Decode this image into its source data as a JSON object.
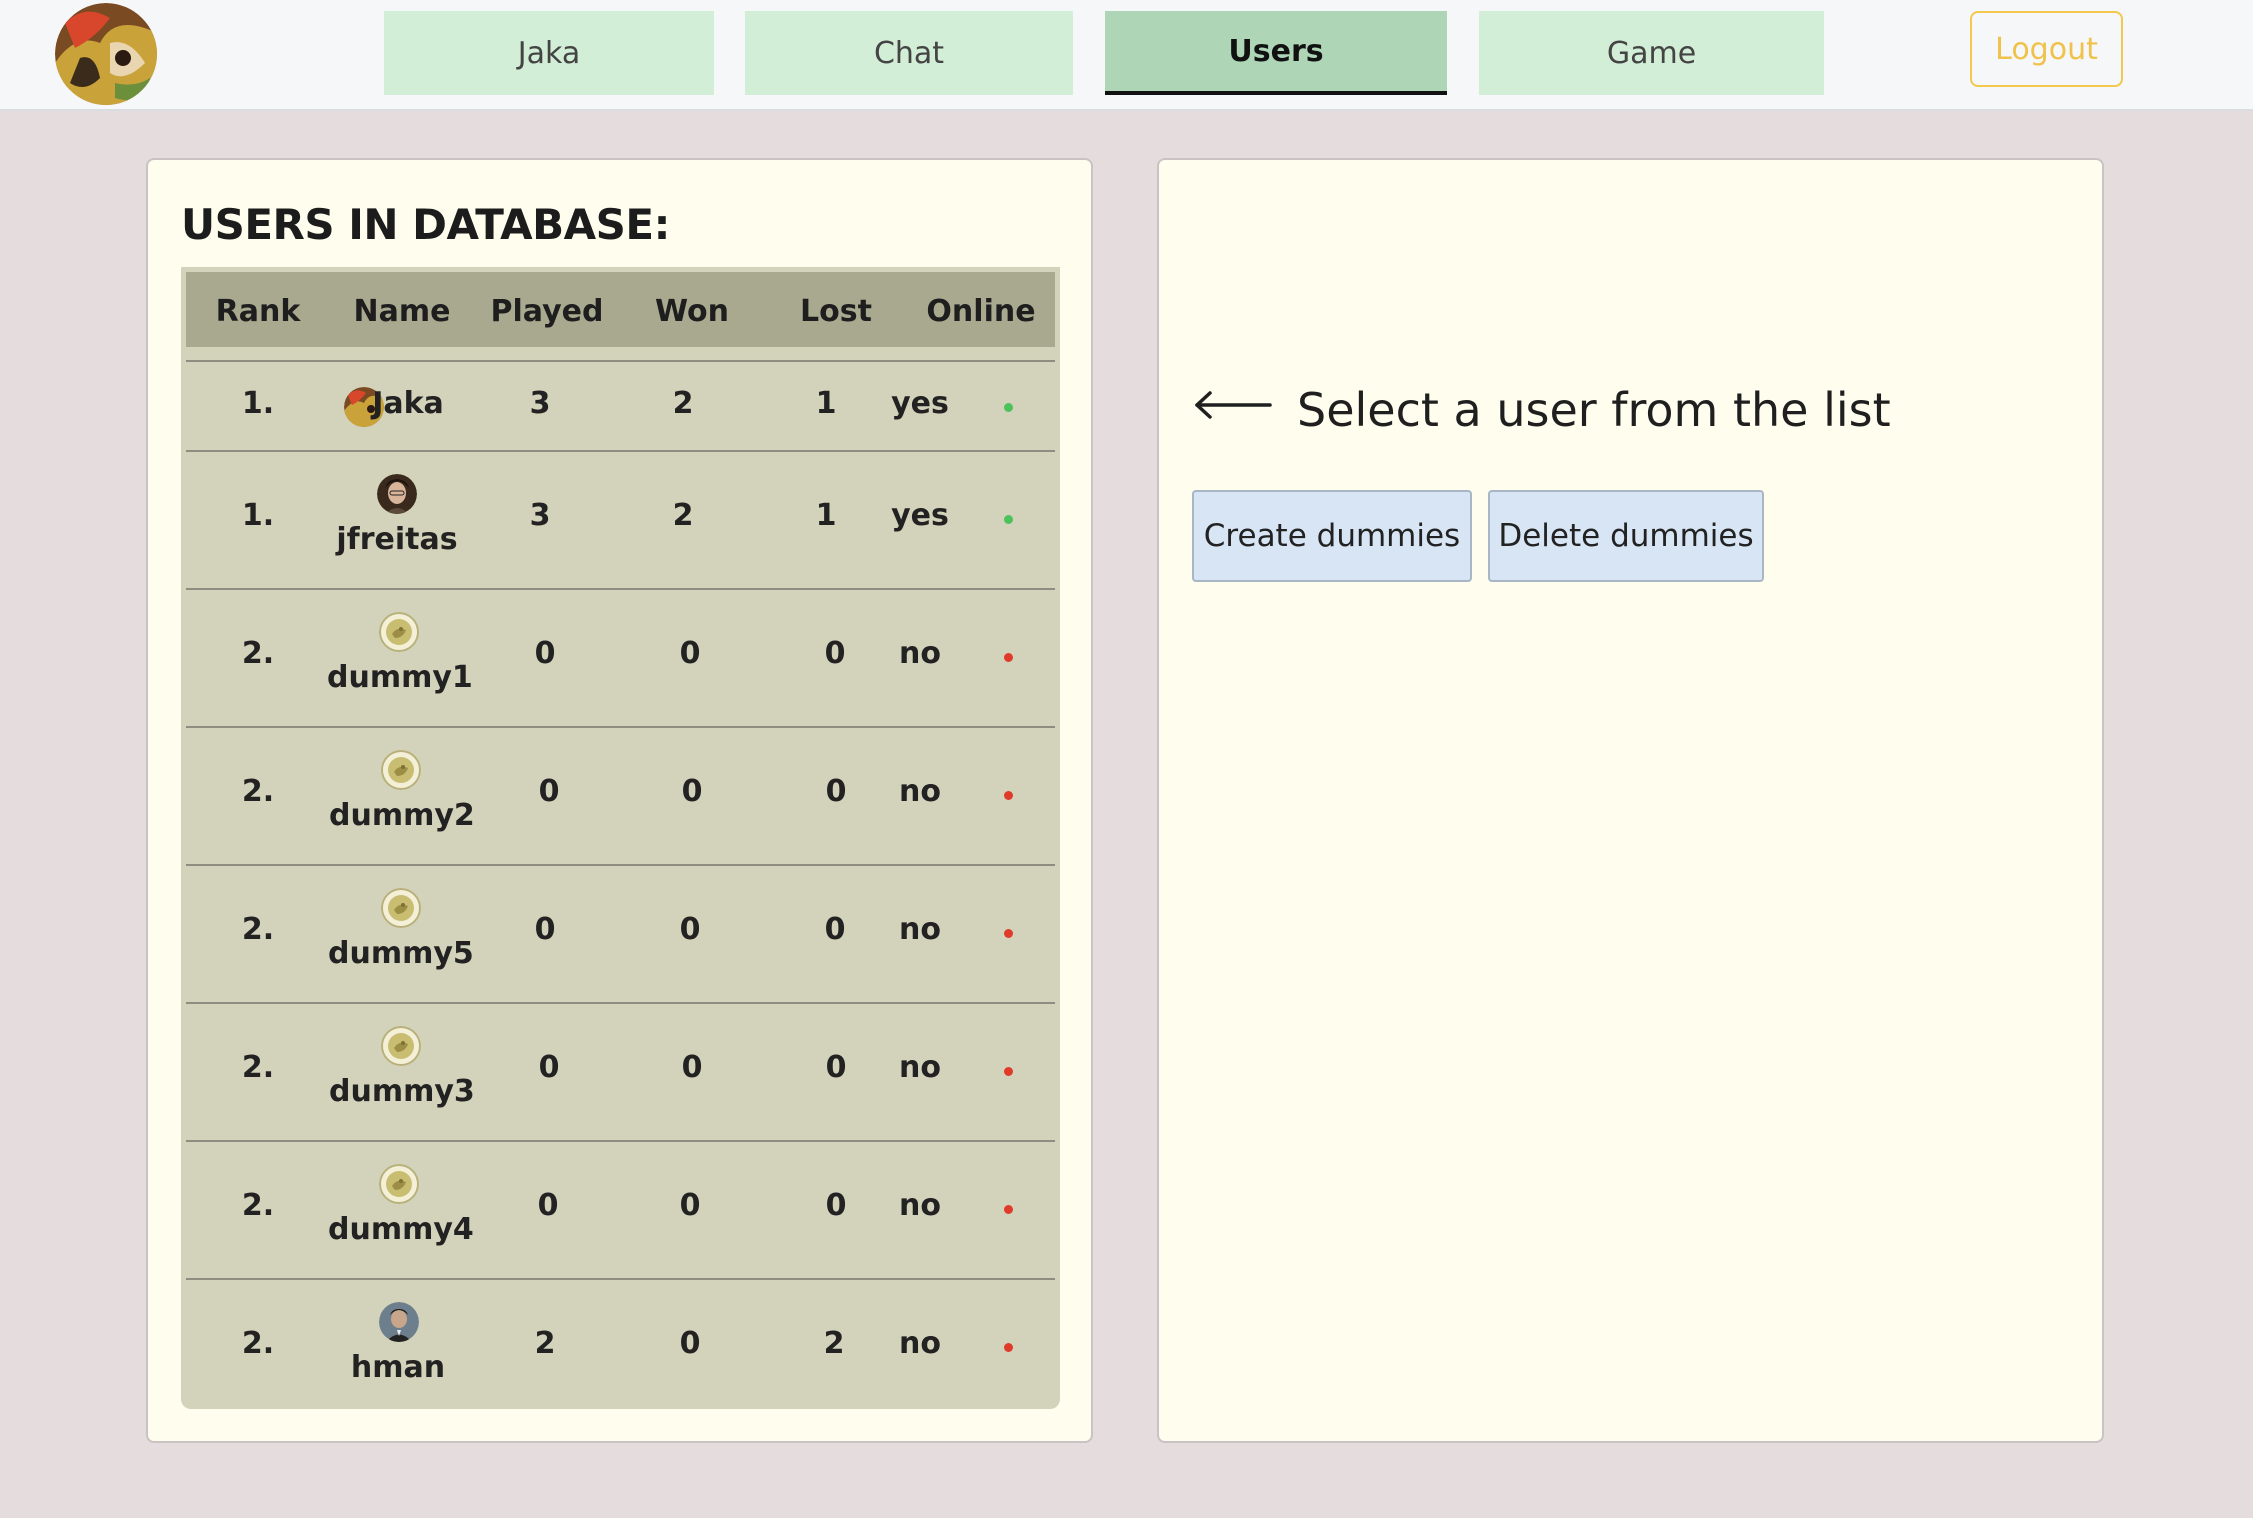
{
  "nav": {
    "tabs": [
      {
        "label": "Jaka",
        "active": false
      },
      {
        "label": "Chat",
        "active": false
      },
      {
        "label": "Users",
        "active": true
      },
      {
        "label": "Game",
        "active": false
      }
    ],
    "logout_label": "Logout"
  },
  "users_panel": {
    "title": "USERS IN DATABASE:",
    "columns": [
      "Rank",
      "Name",
      "Played",
      "Won",
      "Lost",
      "Online"
    ],
    "rows": [
      {
        "rank": "1.",
        "name": "Jaka",
        "played": "3",
        "won": "2",
        "lost": "1",
        "online": "yes",
        "avatar": "jaka-avatar-icon"
      },
      {
        "rank": "1.",
        "name": "jfreitas",
        "played": "3",
        "won": "2",
        "lost": "1",
        "online": "yes",
        "avatar": "user-photo-icon"
      },
      {
        "rank": "2.",
        "name": "dummy1",
        "played": "0",
        "won": "0",
        "lost": "0",
        "online": "no",
        "avatar": "dummy-coin-icon"
      },
      {
        "rank": "2.",
        "name": "dummy2",
        "played": "0",
        "won": "0",
        "lost": "0",
        "online": "no",
        "avatar": "dummy-coin-icon"
      },
      {
        "rank": "2.",
        "name": "dummy5",
        "played": "0",
        "won": "0",
        "lost": "0",
        "online": "no",
        "avatar": "dummy-coin-icon"
      },
      {
        "rank": "2.",
        "name": "dummy3",
        "played": "0",
        "won": "0",
        "lost": "0",
        "online": "no",
        "avatar": "dummy-coin-icon"
      },
      {
        "rank": "2.",
        "name": "dummy4",
        "played": "0",
        "won": "0",
        "lost": "0",
        "online": "no",
        "avatar": "dummy-coin-icon"
      },
      {
        "rank": "2.",
        "name": "hman",
        "played": "2",
        "won": "0",
        "lost": "2",
        "online": "no",
        "avatar": "user-photo-icon"
      }
    ]
  },
  "detail_panel": {
    "hint": "Select a user from the list",
    "create_label": "Create dummies",
    "delete_label": "Delete dummies"
  },
  "colors": {
    "online": "#4cc25a",
    "offline": "#e03a2a",
    "nav_tab": "#d2eed7",
    "nav_tab_active": "#add5b6",
    "logout": "#f1c24a"
  }
}
